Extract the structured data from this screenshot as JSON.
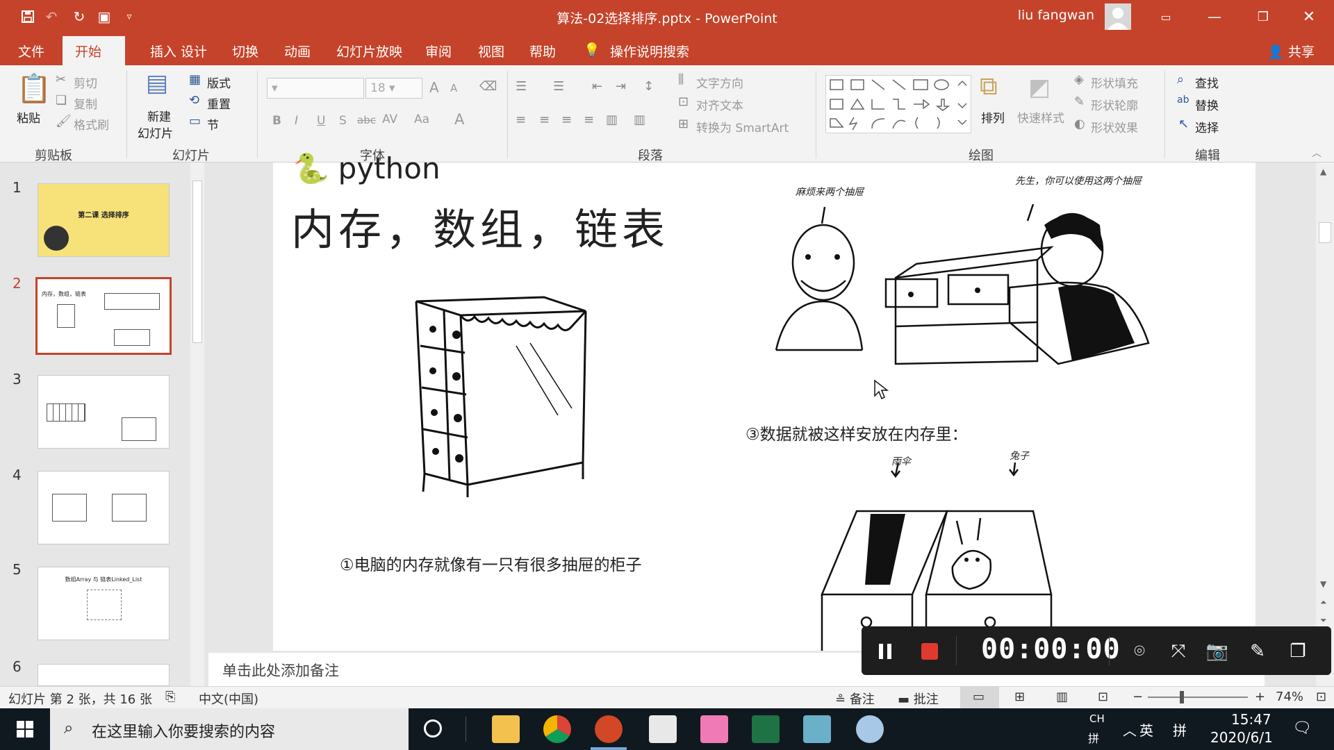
{
  "window": {
    "title": "算法-02选择排序.pptx  -  PowerPoint",
    "user": "liu fangwan"
  },
  "tabs": [
    "文件",
    "开始",
    "插入",
    "设计",
    "切换",
    "动画",
    "幻灯片放映",
    "审阅",
    "视图",
    "帮助"
  ],
  "tell_me": "操作说明搜索",
  "share": "共享",
  "ribbon": {
    "clipboard": {
      "label": "剪贴板",
      "paste": "粘贴",
      "cut": "剪切",
      "copy": "复制",
      "painter": "格式刷"
    },
    "slides": {
      "label": "幻灯片",
      "new_slide_1": "新建",
      "new_slide_2": "幻灯片",
      "layout": "版式",
      "reset": "重置",
      "section": "节"
    },
    "font": {
      "label": "字体",
      "font_size": "18",
      "bold": "B",
      "italic": "I",
      "underline": "U",
      "shadow": "S",
      "strike": "abc",
      "spacing": "AV",
      "case": "Aa",
      "color": "A",
      "grow": "A",
      "shrink": "A"
    },
    "paragraph": {
      "label": "段落",
      "text_direction": "文字方向",
      "align_text": "对齐文本",
      "smartart": "转换为 SmartArt"
    },
    "drawing": {
      "label": "绘图",
      "arrange": "排列",
      "quick_styles": "快速样式",
      "fill": "形状填充",
      "outline": "形状轮廓",
      "effects": "形状效果"
    },
    "editing": {
      "label": "编辑",
      "find": "查找",
      "replace": "替换",
      "select": "选择"
    }
  },
  "thumbnails": [
    {
      "num": "1",
      "title": "第二课 选择排序",
      "bg": "#f7e27a"
    },
    {
      "num": "2",
      "title": "内存，数组，链表",
      "bg": "#ffffff"
    },
    {
      "num": "3",
      "title": "",
      "bg": "#ffffff"
    },
    {
      "num": "4",
      "title": "",
      "bg": "#ffffff"
    },
    {
      "num": "5",
      "title": "数组Array 与 链表Linked_List",
      "bg": "#ffffff"
    },
    {
      "num": "6",
      "title": "",
      "bg": "#ffffff"
    }
  ],
  "slide": {
    "logo_text": "python",
    "title": "内存，数组，链表",
    "caption1": "①电脑的内存就像有一只有很多抽屉的柜子",
    "caption3": "③数据就被这样安放在内存里：",
    "bubble_left": "麻烦来两个抽屉",
    "bubble_right": "先生，你可以使用这两个抽屉",
    "label_umbrella": "雨伞",
    "label_rabbit": "兔子"
  },
  "notes_placeholder": "单击此处添加备注",
  "status": {
    "slide_info": "幻灯片 第 2 张，共 16 张",
    "language": "中文(中国)",
    "notes": "备注",
    "comments": "批注",
    "zoom": "74%"
  },
  "recorder": {
    "time": "00:00:00"
  },
  "taskbar": {
    "search": "在这里输入你要搜索的内容",
    "ime1": "CH",
    "ime2": "拼",
    "lang": "英",
    "ime3": "拼",
    "time": "15:47",
    "date": "2020/6/1"
  },
  "colors": {
    "accent": "#c5432a",
    "recorder_bg": "#1e1e1e",
    "record_red": "#e03a2f"
  }
}
